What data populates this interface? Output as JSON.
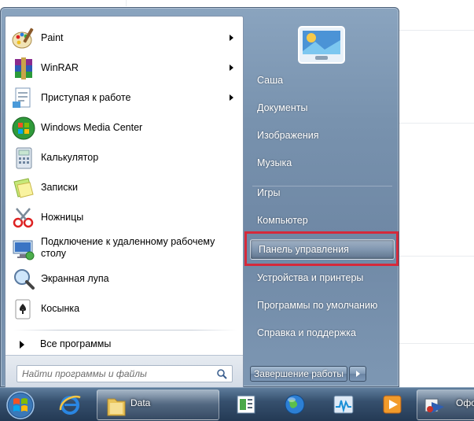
{
  "left_pane": {
    "programs": [
      {
        "label": "Paint",
        "icon": "paint-icon",
        "has_submenu": true
      },
      {
        "label": "WinRAR",
        "icon": "winrar-icon",
        "has_submenu": true
      },
      {
        "label": "Приступая к работе",
        "icon": "getting-started-icon",
        "has_submenu": true
      },
      {
        "label": "Windows Media Center",
        "icon": "media-center-icon",
        "has_submenu": false
      },
      {
        "label": "Калькулятор",
        "icon": "calculator-icon",
        "has_submenu": false
      },
      {
        "label": "Записки",
        "icon": "sticky-notes-icon",
        "has_submenu": false
      },
      {
        "label": "Ножницы",
        "icon": "snipping-tool-icon",
        "has_submenu": false
      },
      {
        "label": "Подключение к удаленному рабочему столу",
        "icon": "remote-desktop-icon",
        "has_submenu": false
      },
      {
        "label": "Экранная лупа",
        "icon": "magnifier-icon",
        "has_submenu": false
      },
      {
        "label": "Косынка",
        "icon": "solitaire-icon",
        "has_submenu": false
      }
    ],
    "all_programs_label": "Все программы",
    "search_placeholder": "Найти программы и файлы"
  },
  "right_pane": {
    "items": [
      {
        "label": "Саша"
      },
      {
        "label": "Документы"
      },
      {
        "label": "Изображения"
      },
      {
        "label": "Музыка"
      },
      {
        "label": "Игры"
      },
      {
        "label": "Компьютер"
      },
      {
        "label": "Панель управления",
        "highlighted": true
      },
      {
        "label": "Устройства и принтеры"
      },
      {
        "label": "Программы по умолчанию"
      },
      {
        "label": "Справка и поддержка"
      }
    ],
    "shutdown_label": "Завершение работы"
  },
  "taskbar": {
    "data_window_label": "Data",
    "office_window_label": "Офо"
  },
  "colors": {
    "highlight_frame": "#d52a3b",
    "menu_glass": "#7892ae",
    "taskbar": "#243a55"
  }
}
